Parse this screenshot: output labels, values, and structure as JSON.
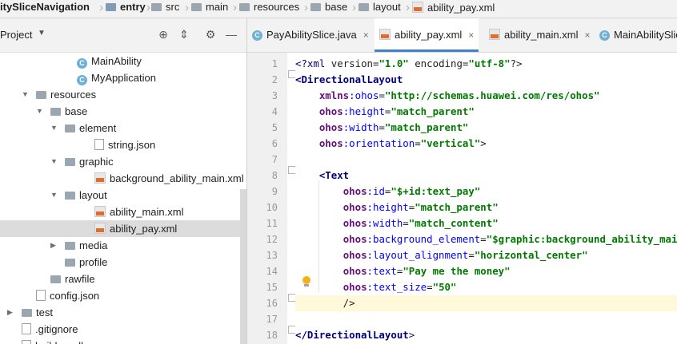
{
  "breadcrumb": {
    "project": "itySliceNavigation",
    "items": [
      "entry",
      "src",
      "main",
      "resources",
      "base",
      "layout",
      "ability_pay.xml"
    ]
  },
  "project_panel": {
    "title": "Project",
    "icons": [
      "crosshair-icon",
      "collapse-icon",
      "gear-icon",
      "minimize-icon"
    ]
  },
  "tree": [
    {
      "label": "MainAbility",
      "icon": "class",
      "expanded": null,
      "selected": false
    },
    {
      "label": "MyApplication",
      "icon": "class",
      "expanded": null,
      "selected": false
    },
    {
      "label": "resources",
      "icon": "folder",
      "expanded": true,
      "selected": false
    },
    {
      "label": "base",
      "icon": "folder",
      "expanded": true,
      "selected": false
    },
    {
      "label": "element",
      "icon": "folder",
      "expanded": true,
      "selected": false
    },
    {
      "label": "string.json",
      "icon": "json",
      "expanded": null,
      "selected": false
    },
    {
      "label": "graphic",
      "icon": "folder",
      "expanded": true,
      "selected": false
    },
    {
      "label": "background_ability_main.xml",
      "icon": "xml",
      "expanded": null,
      "selected": false
    },
    {
      "label": "layout",
      "icon": "folder",
      "expanded": true,
      "selected": false
    },
    {
      "label": "ability_main.xml",
      "icon": "xml",
      "expanded": null,
      "selected": false
    },
    {
      "label": "ability_pay.xml",
      "icon": "xml",
      "expanded": null,
      "selected": true
    },
    {
      "label": "media",
      "icon": "folder",
      "expanded": false,
      "selected": false
    },
    {
      "label": "profile",
      "icon": "folder",
      "expanded": null,
      "selected": false
    },
    {
      "label": "rawfile",
      "icon": "folder",
      "expanded": null,
      "selected": false
    },
    {
      "label": "config.json",
      "icon": "json",
      "expanded": null,
      "selected": false
    },
    {
      "label": "test",
      "icon": "folder",
      "expanded": false,
      "selected": false
    },
    {
      "label": ".gitignore",
      "icon": "file",
      "expanded": null,
      "selected": false
    },
    {
      "label": "build.gradle",
      "icon": "file",
      "expanded": null,
      "selected": false
    }
  ],
  "tabs": [
    {
      "label": "PayAbilitySlice.java",
      "icon": "class",
      "active": false
    },
    {
      "label": "ability_pay.xml",
      "icon": "xml",
      "active": true
    },
    {
      "label": "ability_main.xml",
      "icon": "xml",
      "active": false
    },
    {
      "label": "MainAbilitySlice",
      "icon": "class",
      "active": false
    }
  ],
  "tab_close": "×",
  "editor": {
    "line_numbers": [
      "1",
      "2",
      "3",
      "4",
      "5",
      "6",
      "7",
      "8",
      "9",
      "10",
      "11",
      "12",
      "13",
      "14",
      "15",
      "16",
      "17",
      "18"
    ],
    "lines": [
      "<?xml version=\"1.0\" encoding=\"utf-8\"?>",
      "<DirectionalLayout",
      "    xmlns:ohos=\"http://schemas.huawei.com/res/ohos\"",
      "    ohos:height=\"match_parent\"",
      "    ohos:width=\"match_parent\"",
      "    ohos:orientation=\"vertical\">",
      "",
      "    <Text",
      "        ohos:id=\"$+id:text_pay\"",
      "        ohos:height=\"match_parent\"",
      "        ohos:width=\"match_content\"",
      "        ohos:background_element=\"$graphic:background_ability_main\"",
      "        ohos:layout_alignment=\"horizontal_center\"",
      "        ohos:text=\"Pay me the money\"",
      "        ohos:text_size=\"50\"",
      "        />",
      "",
      "</DirectionalLayout>"
    ],
    "caret_line": 16,
    "colors": {
      "tag": "#00007f",
      "attr": "#0000ff",
      "value": "#007a00",
      "namespace": "#660e7a",
      "caret_line_bg": "#fff8d9"
    }
  }
}
